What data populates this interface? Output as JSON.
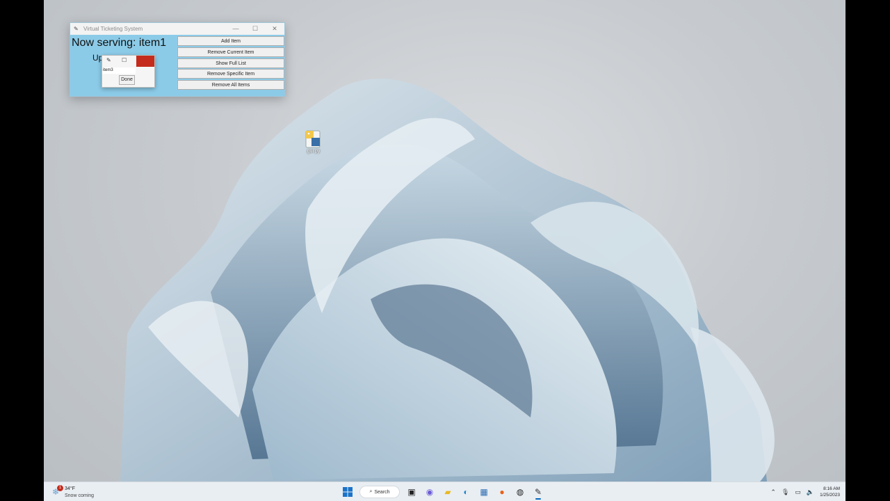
{
  "window": {
    "title": "Virtual Ticketing System",
    "serving": "Now serving: item1",
    "upnext": "Up",
    "buttons": [
      "Add Item",
      "Remove Current Item",
      "Show Full List",
      "Remove Specific Item",
      "Remove All Items"
    ]
  },
  "dialog": {
    "input_value": "item3",
    "done_label": "Done"
  },
  "desktop_icon": {
    "label": "gui.py"
  },
  "taskbar": {
    "temp": "34°F",
    "weather": "Snow coming",
    "weather_badge": "1",
    "search_label": "Search",
    "time": "8:16 AM",
    "date": "1/25/2023"
  }
}
